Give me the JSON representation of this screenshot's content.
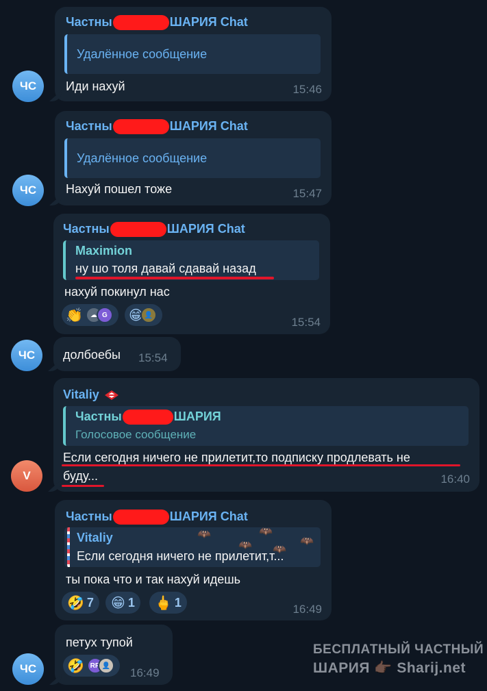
{
  "messages": [
    {
      "sender_left": "Частны",
      "sender_right": "ШАРИЯ Chat",
      "quote_text": "Удалённое сообщение",
      "text": "Иди нахуй",
      "time": "15:46",
      "avatar": "ЧС"
    },
    {
      "sender_left": "Частны",
      "sender_right": "ШАРИЯ Chat",
      "quote_text": "Удалённое сообщение",
      "text": "Нахуй пошел тоже",
      "time": "15:47",
      "avatar": "ЧС"
    },
    {
      "sender_left": "Частны",
      "sender_right": "ШАРИЯ Chat",
      "quote_name": "Maximion",
      "quote_text": "ну шо толя давай сдавай назад",
      "text": "нахуй покинул нас",
      "time": "15:54",
      "reactions": [
        {
          "icon": "👏",
          "avatars": [
            "cloud",
            "G"
          ]
        },
        {
          "icon": "😁",
          "avatars": [
            "person"
          ]
        }
      ]
    },
    {
      "text": "долбоебы",
      "time": "15:54",
      "avatar": "ЧС"
    },
    {
      "sender": "Vitaliy",
      "badge_icon": "spartak-logo-icon",
      "quote_name_left": "Частны",
      "quote_name_right": "ШАРИЯ",
      "quote_text": "Голосовое сообщение",
      "text_line1": "Если сегодня ничего не прилетит,то подписку продлевать не",
      "text_line2": "буду...",
      "time": "16:40",
      "avatar": "V"
    },
    {
      "sender_left": "Частны",
      "sender_right": "ШАРИЯ Chat",
      "quote_name": "Vitaliy",
      "quote_text": "Если сегодня ничего не прилетит,т...",
      "text": "ты пока что и так нахуй идешь",
      "time": "16:49",
      "reactions": [
        {
          "icon": "🤣",
          "count": "7"
        },
        {
          "icon": "😁",
          "count": "1"
        },
        {
          "icon": "🖕",
          "count": "1"
        }
      ]
    },
    {
      "text": "петух тупой",
      "time": "16:49",
      "avatar": "ЧС",
      "reactions": [
        {
          "icon": "🤣",
          "avatars": [
            "RR",
            "person"
          ]
        }
      ]
    }
  ],
  "watermark": {
    "line1": "БЕСПЛАТНЫЙ ЧАСТНЫЙ",
    "line2_left": "ШАРИЯ",
    "line2_icon": "👉🏿",
    "line2_right": "Sharij.net"
  },
  "colors": {
    "background": "#0e1621",
    "bubble": "#182533",
    "accent_blue": "#6ab3f3",
    "accent_teal": "#73d2d8",
    "redaction": "#ff1a1a",
    "underline": "#e0152a"
  }
}
